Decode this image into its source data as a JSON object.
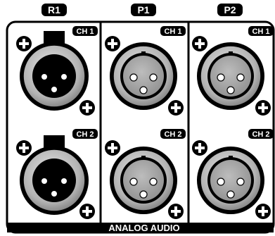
{
  "panel": {
    "footer_label": "ANALOG AUDIO",
    "colors": {
      "ink": "#000000",
      "paper": "#ffffff",
      "metal_light": "#c8c8c8",
      "metal_dark": "#6a6a6a",
      "pin_face": "#a7a7a7"
    }
  },
  "groups": [
    {
      "label": "R1",
      "connector": "female",
      "channels": [
        {
          "label": "CH 1"
        },
        {
          "label": "CH 2"
        }
      ]
    },
    {
      "label": "P1",
      "connector": "male",
      "channels": [
        {
          "label": "CH 1"
        },
        {
          "label": "CH 2"
        }
      ]
    },
    {
      "label": "P2",
      "connector": "male",
      "channels": [
        {
          "label": "CH 1"
        },
        {
          "label": "CH 2"
        }
      ]
    }
  ]
}
